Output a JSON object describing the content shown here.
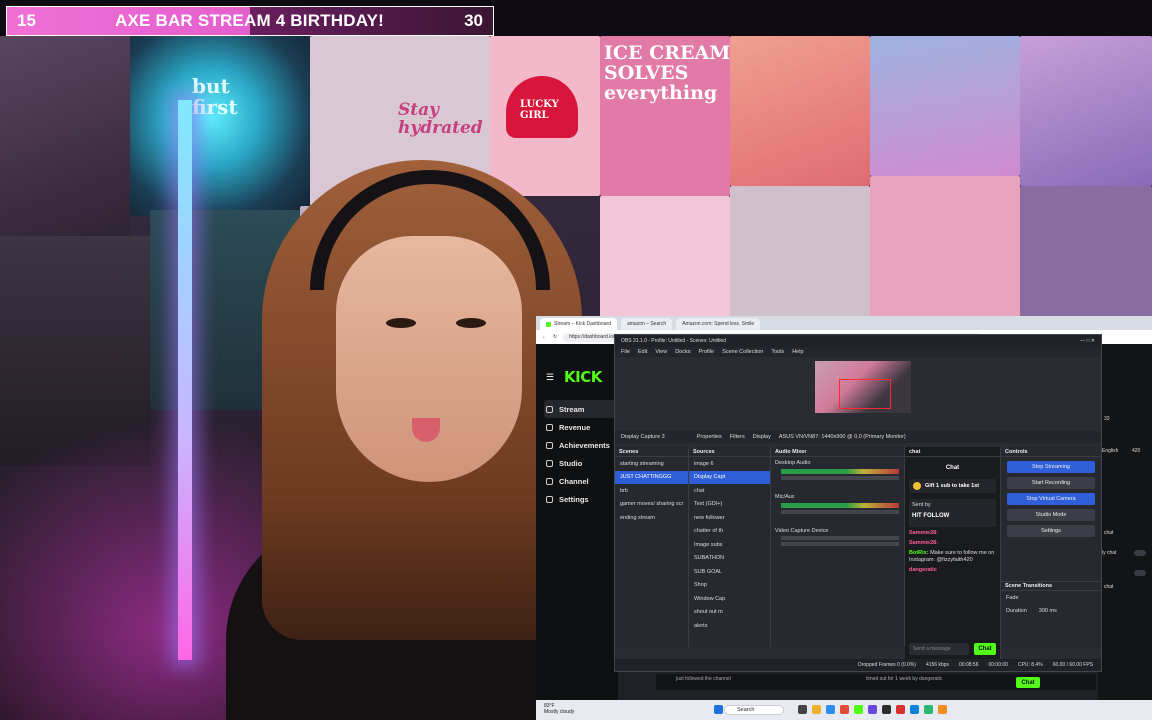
{
  "overlay": {
    "left_number": "15",
    "title": "AXE BAR STREAM 4 BIRTHDAY!",
    "right_number": "30"
  },
  "posters": {
    "ice_cream": "ICE CREAM\nSOLVES\neverything",
    "lucky_girl": "LUCKY\nGIRL",
    "stay_hydrated": "Stay\nhydrated",
    "but_first": "but\nfirst"
  },
  "browser": {
    "tabs": [
      "Stream – Kick Dashboard",
      "amazon – Search",
      "Amazon.com: Spend less. Smile"
    ],
    "url": "https://dashboard.kick.com/stream"
  },
  "kick": {
    "logo": "KICK",
    "nav": [
      "Stream",
      "Revenue",
      "Achievements",
      "Studio",
      "Channel",
      "Settings"
    ]
  },
  "obs": {
    "window_title": "OBS 31.1.0 - Profile: Untitled - Scenes: Untitled",
    "menu": [
      "File",
      "Edit",
      "View",
      "Docks",
      "Profile",
      "Scene Collection",
      "Tools",
      "Help"
    ],
    "source_bar": {
      "selected_source": "Display Capture 3",
      "properties": "Properties",
      "filters": "Filters",
      "display_label": "Display",
      "display_value": "ASUS VN/VN87: 1440x900 @ 0,0 (Primary Monitor)"
    },
    "scenes": {
      "header": "Scenes",
      "items": [
        "starting streaming",
        "JUST CHATTINGGG",
        "brb",
        "gamer moves/ sharing scr",
        "ending stream"
      ],
      "selected": "JUST CHATTINGGG"
    },
    "sources": {
      "header": "Sources",
      "items": [
        "image 6",
        "Display Capt",
        "chat",
        "Text (GDI+)",
        "new follower",
        "chatter of th",
        "Image subs",
        "SUBATHON",
        "SUB GOAL",
        "Shop",
        "Window Cap",
        "shout out m",
        "alerts"
      ]
    },
    "audio": {
      "header": "Audio Mixer",
      "channels": [
        "Desktop Audio",
        "Mic/Aux",
        "Video Capture Device"
      ]
    },
    "chat": {
      "header": "chat",
      "title": "Chat",
      "gift": "Gift 1 sub to take 1st",
      "pinned_label": "Sent by",
      "pinned_text": "HIT FOLLOW",
      "messages": [
        {
          "user": "Sammie28:",
          "text": ""
        },
        {
          "user": "Sammie28:",
          "text": ""
        },
        {
          "user": "BotRix:",
          "text": "Make sure to follow me on Instagram: @fizzyfaith420"
        },
        {
          "user": "dangeratic",
          "text": ""
        }
      ],
      "input_placeholder": "Send a message",
      "send": "Chat"
    },
    "controls": {
      "header": "Controls",
      "buttons": [
        "Stop Streaming",
        "Start Recording",
        "Stop Virtual Camera",
        "Studio Mode",
        "Settings"
      ]
    },
    "transitions": {
      "header": "Scene Transitions",
      "type": "Fade",
      "duration_label": "Duration",
      "duration_value": "300 ms"
    },
    "status": {
      "dropped": "Dropped Frames 0 (0.0%)",
      "kbps": "4156 kbps",
      "live_time": "00:08:56",
      "rec_time": "00:00:00",
      "cpu": "CPU: 8.4%",
      "fps": "60.00 / 60.00 FPS"
    }
  },
  "kick_chat": {
    "events": [
      "just followed the channel",
      "timed out for 1 week by dangeratic"
    ],
    "send": "Chat"
  },
  "right_panel": {
    "viewer_count": "33",
    "language": "English",
    "count": "420",
    "labels": [
      "chat",
      "ly chat",
      "chat"
    ]
  },
  "taskbar": {
    "weather_temp": "83°F",
    "weather_desc": "Mostly cloudy",
    "search_placeholder": "Search"
  },
  "colors": {
    "kick_green": "#53fc18",
    "obs_selection": "#2e5fd8",
    "overlay_pink": "#f070d6"
  }
}
